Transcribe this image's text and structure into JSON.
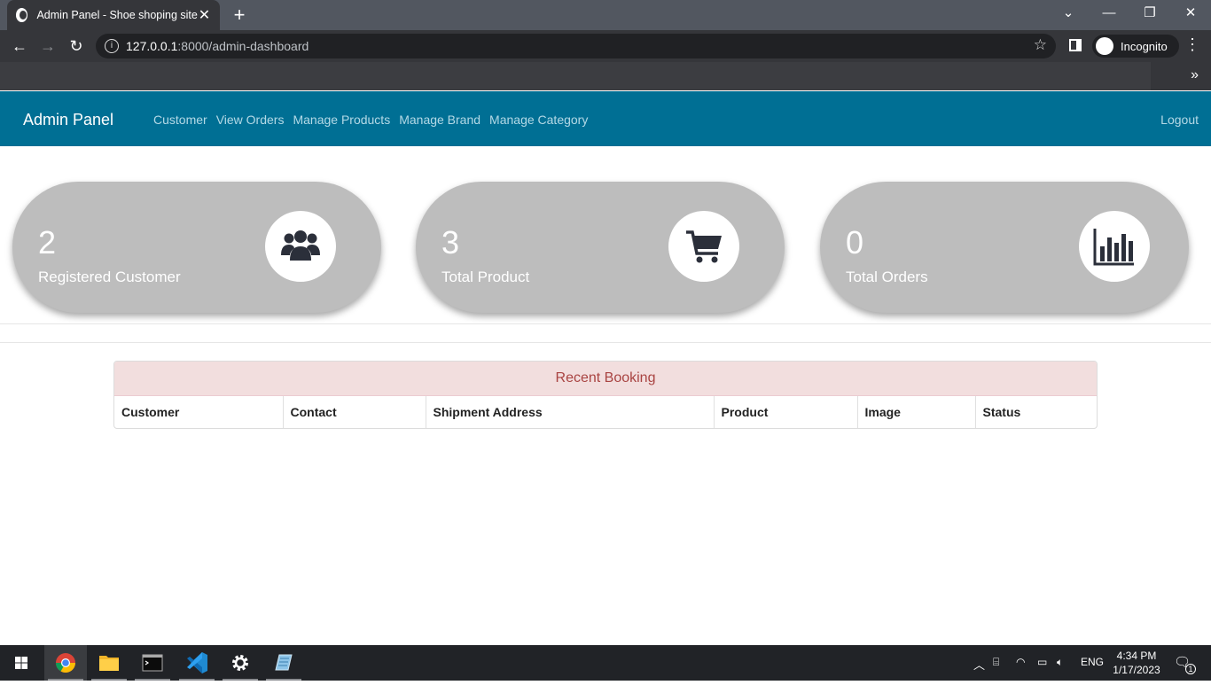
{
  "browser": {
    "tab_title": "Admin Panel - Shoe shoping site",
    "url_host": "127.0.0.1",
    "url_rest": ":8000/admin-dashboard",
    "profile_label": "Incognito"
  },
  "navbar": {
    "brand": "Admin Panel",
    "links": [
      "Customer",
      "View Orders",
      "Manage Products",
      "Manage Brand",
      "Manage Category"
    ],
    "logout": "Logout"
  },
  "cards": [
    {
      "value": "2",
      "label": "Registered Customer",
      "icon": "users-icon"
    },
    {
      "value": "3",
      "label": "Total Product",
      "icon": "cart-icon"
    },
    {
      "value": "0",
      "label": "Total Orders",
      "icon": "bar-chart-icon"
    }
  ],
  "recent_booking": {
    "title": "Recent Booking",
    "columns": [
      "Customer",
      "Contact",
      "Shipment Address",
      "Product",
      "Image",
      "Status"
    ]
  },
  "taskbar": {
    "apps": [
      "windows-start-icon",
      "chrome-icon",
      "file-explorer-icon",
      "terminal-icon",
      "vscode-icon",
      "settings-icon",
      "notepad-icon"
    ],
    "language": "ENG",
    "time": "4:34 PM",
    "date": "1/17/2023",
    "notification_count": "1"
  },
  "colors": {
    "navbar": "#006f94",
    "card": "#bdbdbd",
    "booking_header_bg": "#f2dede",
    "booking_header_text": "#a94442"
  }
}
